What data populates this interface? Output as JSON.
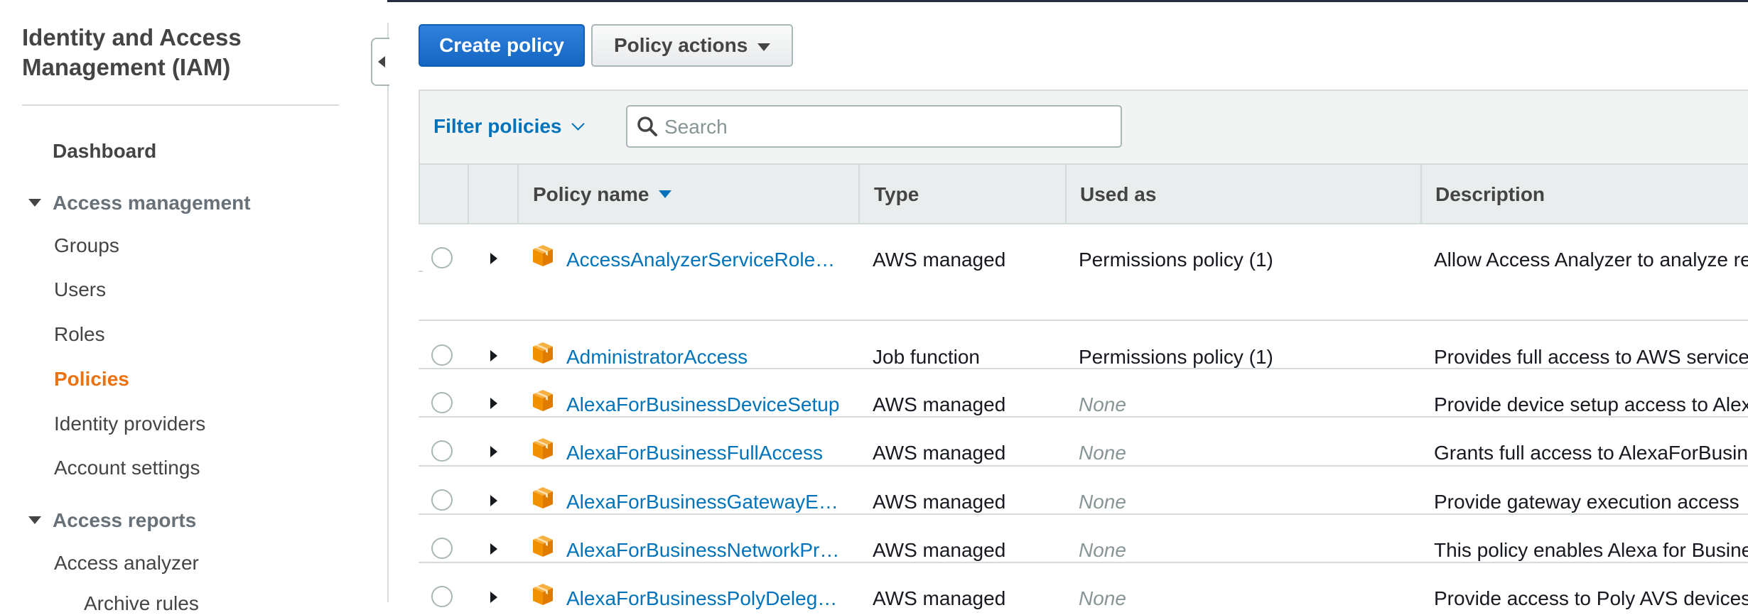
{
  "sidebar": {
    "title": "Identity and Access Management (IAM)",
    "dashboard": "Dashboard",
    "section_access_management": "Access management",
    "items": [
      "Groups",
      "Users",
      "Roles",
      "Policies",
      "Identity providers",
      "Account settings"
    ],
    "active_item": "Policies",
    "section_access_reports": "Access reports",
    "reports_items": [
      "Access analyzer",
      "Archive rules"
    ]
  },
  "toolbar": {
    "create_policy": "Create policy",
    "policy_actions": "Policy actions"
  },
  "filter": {
    "label": "Filter policies",
    "search_placeholder": "Search",
    "search_value": ""
  },
  "table": {
    "columns": [
      "Policy name",
      "Type",
      "Used as",
      "Description"
    ],
    "sort_column": "Policy name",
    "rows": [
      {
        "name": "AccessAnalyzerServiceRole…",
        "type": "AWS managed",
        "used_as": "Permissions policy (1)",
        "description": "Allow Access Analyzer to analyze re"
      },
      {
        "name": "AdministratorAccess",
        "type": "Job function",
        "used_as": "Permissions policy (1)",
        "description": "Provides full access to AWS service"
      },
      {
        "name": "AlexaForBusinessDeviceSetup",
        "type": "AWS managed",
        "used_as": "None",
        "description": "Provide device setup access to Alex"
      },
      {
        "name": "AlexaForBusinessFullAccess",
        "type": "AWS managed",
        "used_as": "None",
        "description": "Grants full access to AlexaForBusin"
      },
      {
        "name": "AlexaForBusinessGatewayE…",
        "type": "AWS managed",
        "used_as": "None",
        "description": "Provide gateway execution access"
      },
      {
        "name": "AlexaForBusinessNetworkPr…",
        "type": "AWS managed",
        "used_as": "None",
        "description": "This policy enables Alexa for Busine"
      },
      {
        "name": "AlexaForBusinessPolyDeleg…",
        "type": "AWS managed",
        "used_as": "None",
        "description": "Provide access to Poly AVS devices"
      }
    ]
  },
  "colors": {
    "primary_button": "#1466c3",
    "link": "#0073bb",
    "active_nav": "#ec7211",
    "package_icon": "#f29100"
  },
  "icons": {
    "search": "search-icon",
    "policy": "package-icon",
    "collapse": "chevron-left-icon"
  }
}
